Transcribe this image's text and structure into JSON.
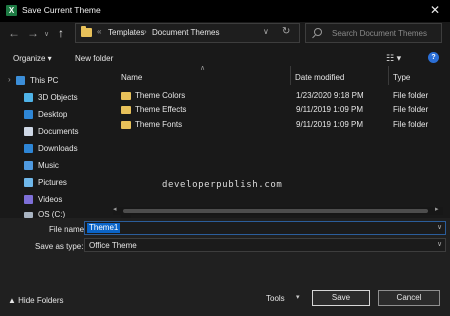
{
  "window": {
    "title": "Save Current Theme",
    "app_icon_letter": "X"
  },
  "address": {
    "breadcrumbs": [
      "Templates",
      "Document Themes"
    ],
    "overflow": "«",
    "separator": "›"
  },
  "search": {
    "placeholder": "Search Document Themes"
  },
  "toolbar": {
    "organize_label": "Organize ▾",
    "new_folder_label": "New folder",
    "view_label": "☷ ▾",
    "help_label": "?"
  },
  "nav_pane": {
    "items": [
      {
        "label": "This PC",
        "icon": "pc-icon",
        "color": "#3c8ed8",
        "top_level": true
      },
      {
        "label": "3D Objects",
        "icon": "3d-objects-icon",
        "color": "#4fb3e8"
      },
      {
        "label": "Desktop",
        "icon": "desktop-icon",
        "color": "#2e86d6"
      },
      {
        "label": "Documents",
        "icon": "documents-icon",
        "color": "#cfd8e6"
      },
      {
        "label": "Downloads",
        "icon": "downloads-icon",
        "color": "#2e86d6"
      },
      {
        "label": "Music",
        "icon": "music-icon",
        "color": "#4f9ae0"
      },
      {
        "label": "Pictures",
        "icon": "pictures-icon",
        "color": "#6fb7ea"
      },
      {
        "label": "Videos",
        "icon": "videos-icon",
        "color": "#7e6fd8"
      },
      {
        "label": "OS (C:)",
        "icon": "drive-icon",
        "color": "#a9b4c2"
      }
    ]
  },
  "file_list": {
    "columns": [
      "Name",
      "Date modified",
      "Type"
    ],
    "rows": [
      {
        "name": "Theme Colors",
        "date": "1/23/2020 9:18 PM",
        "type": "File folder"
      },
      {
        "name": "Theme Effects",
        "date": "9/11/2019 1:09 PM",
        "type": "File folder"
      },
      {
        "name": "Theme Fonts",
        "date": "9/11/2019 1:09 PM",
        "type": "File folder"
      }
    ]
  },
  "watermark": "developerpublish.com",
  "form": {
    "filename_label": "File name:",
    "filename_value": "Theme1",
    "savetype_label": "Save as type:",
    "savetype_value": "Office Theme"
  },
  "footer": {
    "hide_folders_label": "▲  Hide Folders",
    "tools_label": "Tools",
    "save_label": "Save",
    "cancel_label": "Cancel"
  },
  "glyphs": {
    "close": "✕",
    "back": "←",
    "forward": "→",
    "recent": "∨",
    "up": "↑",
    "dropdown": "∨",
    "refresh": "↻",
    "sort": "∧",
    "scroll_up": "▴",
    "scroll_down": "▾",
    "scroll_left": "◂",
    "scroll_right": "▸",
    "caret_down": "▾",
    "nav_expand": "›"
  },
  "colors": {
    "accent": "#0a64c8",
    "folder": "#e8c15a",
    "background": "#191919"
  }
}
